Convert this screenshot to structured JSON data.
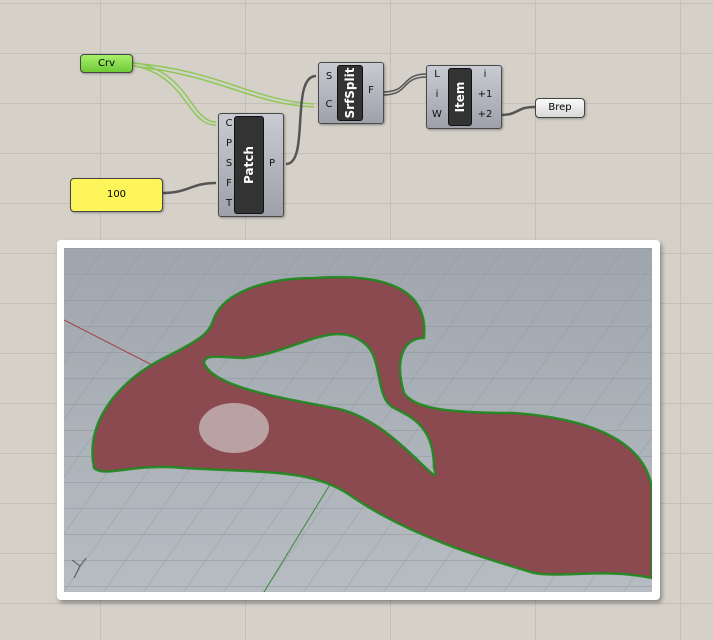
{
  "components": {
    "crv": {
      "label": "Crv"
    },
    "slider": {
      "value": "100"
    },
    "patch": {
      "name": "Patch",
      "inputs": [
        "C",
        "P",
        "S",
        "F",
        "T"
      ],
      "outputs": [
        "P"
      ]
    },
    "srfsplit": {
      "name": "SrfSplit",
      "inputs": [
        "S",
        "C"
      ],
      "outputs": [
        "F"
      ]
    },
    "item": {
      "name": "Item",
      "inputs": [
        "L",
        "i",
        "W"
      ],
      "outputs": [
        "i",
        "+1",
        "+2"
      ]
    },
    "brep": {
      "label": "Brep"
    }
  },
  "colors": {
    "canvas": "#d5d1c9",
    "curve_param": "#8ee04a",
    "slider": "#ffff55",
    "surface": "#8a3b40",
    "edge": "#1f8a1f"
  }
}
